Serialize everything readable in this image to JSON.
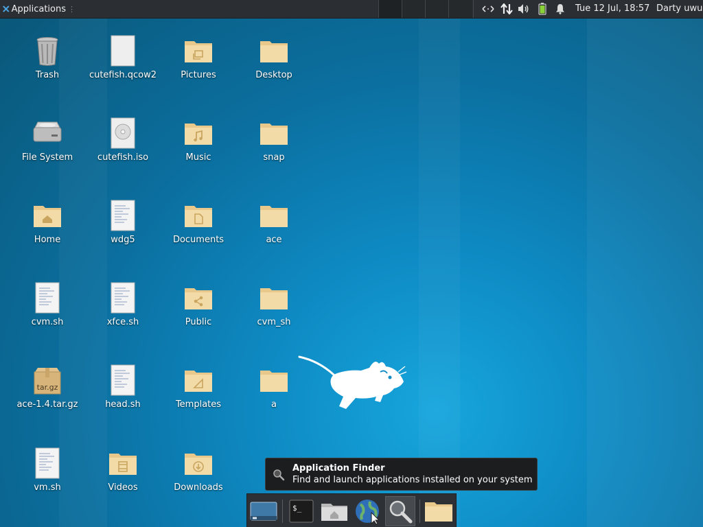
{
  "panel": {
    "app_menu_label": "Applications",
    "grip": "⋮",
    "clock": "Tue 12 Jul, 18:57",
    "user": "Darty uwu",
    "battery_color": "#8bd13a"
  },
  "desktop": {
    "icons": [
      {
        "label": "Trash",
        "kind": "trash-icon"
      },
      {
        "label": "cutefish.qcow2",
        "kind": "file-icon"
      },
      {
        "label": "Pictures",
        "kind": "folder-pictures-icon"
      },
      {
        "label": "Desktop",
        "kind": "folder-icon"
      },
      {
        "label": "File System",
        "kind": "drive-icon"
      },
      {
        "label": "cutefish.iso",
        "kind": "disc-image-icon"
      },
      {
        "label": "Music",
        "kind": "folder-music-icon"
      },
      {
        "label": "snap",
        "kind": "folder-icon"
      },
      {
        "label": "Home",
        "kind": "folder-home-icon"
      },
      {
        "label": "wdg5",
        "kind": "text-file-icon"
      },
      {
        "label": "Documents",
        "kind": "folder-documents-icon"
      },
      {
        "label": "ace",
        "kind": "folder-icon"
      },
      {
        "label": "cvm.sh",
        "kind": "text-file-icon"
      },
      {
        "label": "xfce.sh",
        "kind": "text-file-icon"
      },
      {
        "label": "Public",
        "kind": "folder-public-icon"
      },
      {
        "label": "cvm_sh",
        "kind": "folder-icon"
      },
      {
        "label": "ace-1.4.tar.gz",
        "kind": "archive-icon",
        "badge": "tar.gz"
      },
      {
        "label": "head.sh",
        "kind": "text-file-icon"
      },
      {
        "label": "Templates",
        "kind": "folder-templates-icon"
      },
      {
        "label": "a",
        "kind": "folder-icon"
      },
      {
        "label": "vm.sh",
        "kind": "text-file-icon"
      },
      {
        "label": "Videos",
        "kind": "folder-videos-icon"
      },
      {
        "label": "Downloads",
        "kind": "folder-downloads-icon"
      }
    ]
  },
  "tooltip": {
    "title": "Application Finder",
    "description": "Find and launch applications installed on your system"
  },
  "dock": {
    "items": [
      {
        "name": "show-desktop"
      },
      {
        "name": "terminal",
        "prompt": "$_"
      },
      {
        "name": "file-manager"
      },
      {
        "name": "web-browser"
      },
      {
        "name": "application-finder"
      },
      {
        "name": "folder"
      }
    ]
  }
}
